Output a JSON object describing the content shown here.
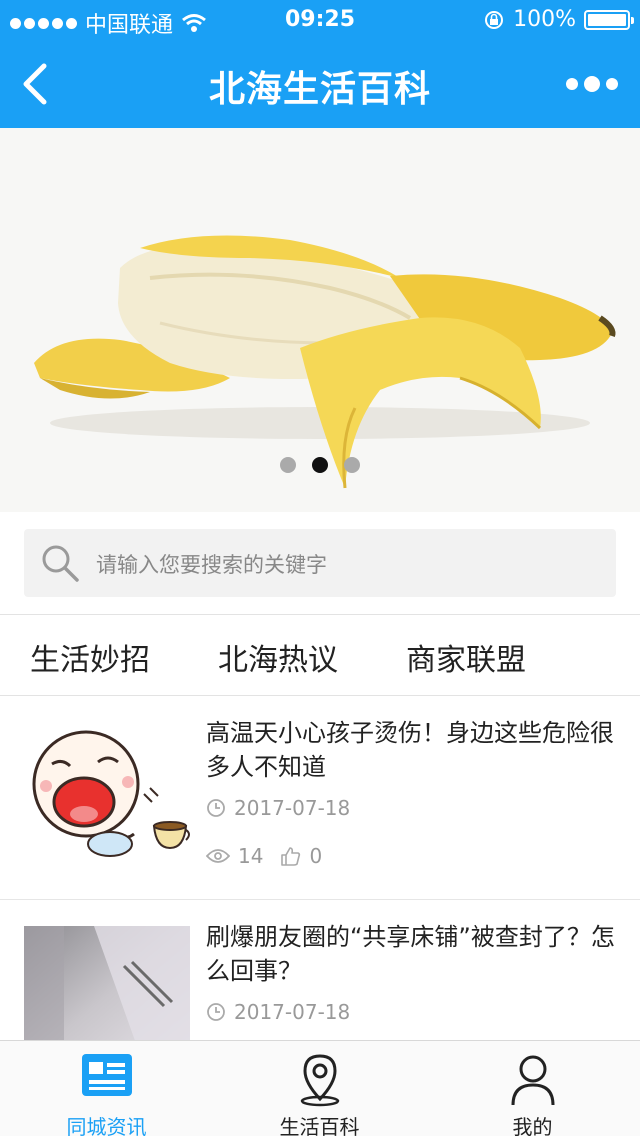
{
  "status_bar": {
    "carrier": "中国联通",
    "time": "09:25",
    "battery": "100%",
    "battery_level": 1.0
  },
  "navbar": {
    "title": "北海生活百科",
    "back_icon": "chevron-left-icon",
    "more_icon": "more-dots-icon"
  },
  "banner": {
    "slide_count": 3,
    "active_index": 1
  },
  "search": {
    "placeholder": "请输入您要搜索的关键字",
    "icon": "search-icon"
  },
  "tabs": [
    {
      "label": "生活妙招"
    },
    {
      "label": "北海热议"
    },
    {
      "label": "商家联盟"
    }
  ],
  "news": [
    {
      "title": "高温天小心孩子烫伤！身边这些危险很多人不知道",
      "date": "2017-07-18",
      "views": "14",
      "likes": "0"
    },
    {
      "title": "刷爆朋友圈的“共享床铺”被查封了？怎么回事？",
      "date": "2017-07-18"
    }
  ],
  "tabbar": [
    {
      "label": "同城资讯",
      "icon": "news-card-icon",
      "active": true
    },
    {
      "label": "生活百科",
      "icon": "location-pin-icon",
      "active": false
    },
    {
      "label": "我的",
      "icon": "user-icon",
      "active": false
    }
  ],
  "colors": {
    "brand": "#1aa0f5",
    "text": "#222222",
    "muted": "#999999"
  }
}
